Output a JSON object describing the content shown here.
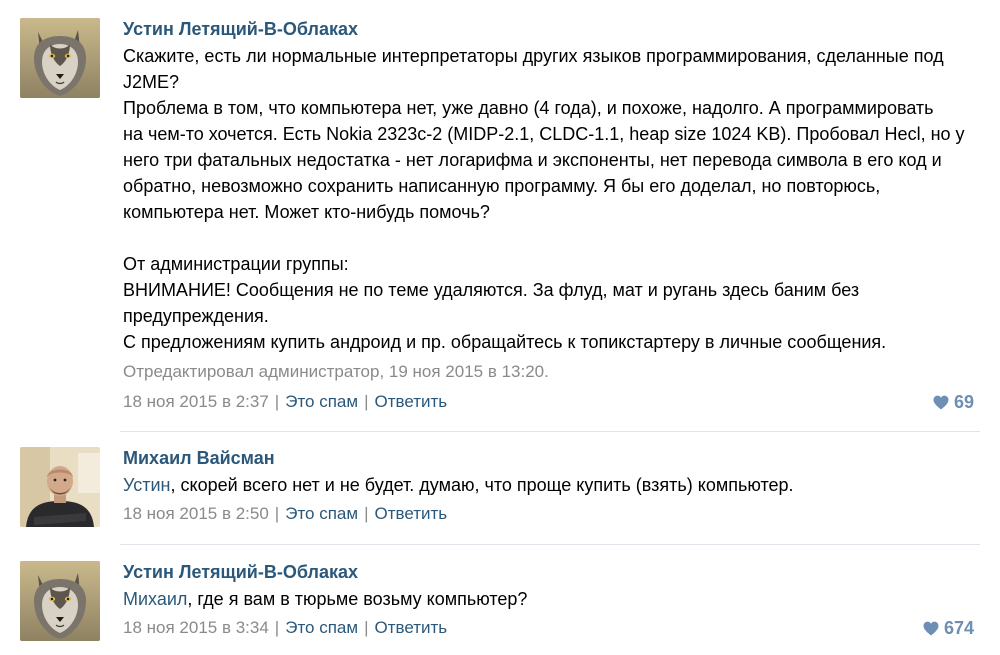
{
  "colors": {
    "link": "#2b587a",
    "meta": "#8a8a8a",
    "like": "#6d8fb3",
    "divider": "#dfe4ea"
  },
  "posts": [
    {
      "author": "Устин Летящий-В-Облаках",
      "avatar": "wolf-avatar",
      "lines": [
        "Скажите, есть ли нормальные интерпретаторы других языков программирования, сделанные под",
        "J2ME?",
        "Проблема в том, что компьютера нет, уже давно (4 года), и похоже, надолго. А программировать",
        "на чем-то хочется. Есть Nokia 2323c-2 (MIDP-2.1, CLDC-1.1, heap size 1024 KB). Пробовал Hecl, но у",
        "него три фатальных недостатка - нет логарифма и экспоненты, нет перевода символа в его код и",
        "обратно, невозможно сохранить написанную программу. Я бы его доделал, но повторюсь,",
        "компьютера нет. Может кто-нибудь помочь?",
        "",
        "От администрации группы:",
        "ВНИМАНИЕ! Сообщения не по теме удаляются. За флуд, мат и ругань здесь баним без",
        "предупреждения.",
        "С предложениям купить андроид и пр. обращайтесь к топикстартеру в личные сообщения."
      ],
      "edited": "Отредактировал администратор, 19 ноя 2015 в 13:20.",
      "date": "18 ноя 2015 в 2:37",
      "separator": "|",
      "spam_label": "Это спам",
      "reply_label": "Ответить",
      "likes": "69"
    },
    {
      "author": "Михаил Вайсман",
      "avatar": "man-avatar",
      "mention": "Устин",
      "text": ", скорей всего нет и не будет. думаю, что проще купить (взять) компьютер.",
      "date": "18 ноя 2015 в 2:50",
      "separator": "|",
      "spam_label": "Это спам",
      "reply_label": "Ответить"
    },
    {
      "author": "Устин Летящий-В-Облаках",
      "avatar": "wolf-avatar",
      "mention": "Михаил",
      "text": ", где я вам в тюрьме возьму компьютер?",
      "date": "18 ноя 2015 в 3:34",
      "separator": "|",
      "spam_label": "Это спам",
      "reply_label": "Ответить",
      "likes": "674"
    }
  ]
}
